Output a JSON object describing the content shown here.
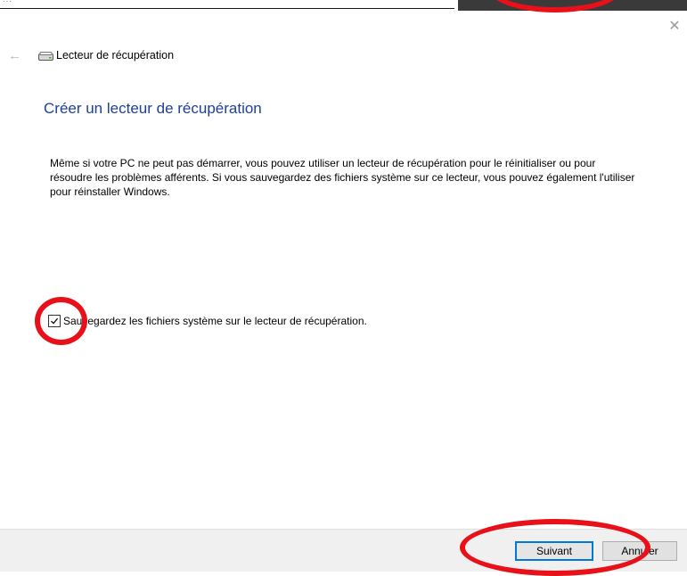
{
  "window": {
    "app_title": "Lecteur de récupération",
    "close_glyph": "✕",
    "back_glyph": "←"
  },
  "main": {
    "heading": "Créer un lecteur de récupération",
    "description": "Même si votre PC ne peut pas démarrer, vous pouvez utiliser un lecteur de récupération pour le réinitialiser ou pour résoudre les problèmes afférents. Si vous sauvegardez des fichiers système sur ce lecteur, vous pouvez également l'utiliser pour réinstaller Windows.",
    "backup_checkbox": {
      "label": "Sauvegardez les fichiers système sur le lecteur de récupération.",
      "checked": true
    }
  },
  "footer": {
    "next_label": "Suivant",
    "cancel_label": "Annuler"
  },
  "colors": {
    "heading": "#1e3f9a",
    "accent_border": "#0078d7",
    "annotation": "#e8111a",
    "footer_bg": "#f0f0f0"
  },
  "icons": {
    "back": "back-arrow-icon",
    "drive": "drive-icon",
    "close": "close-icon",
    "check": "checkmark-icon"
  }
}
